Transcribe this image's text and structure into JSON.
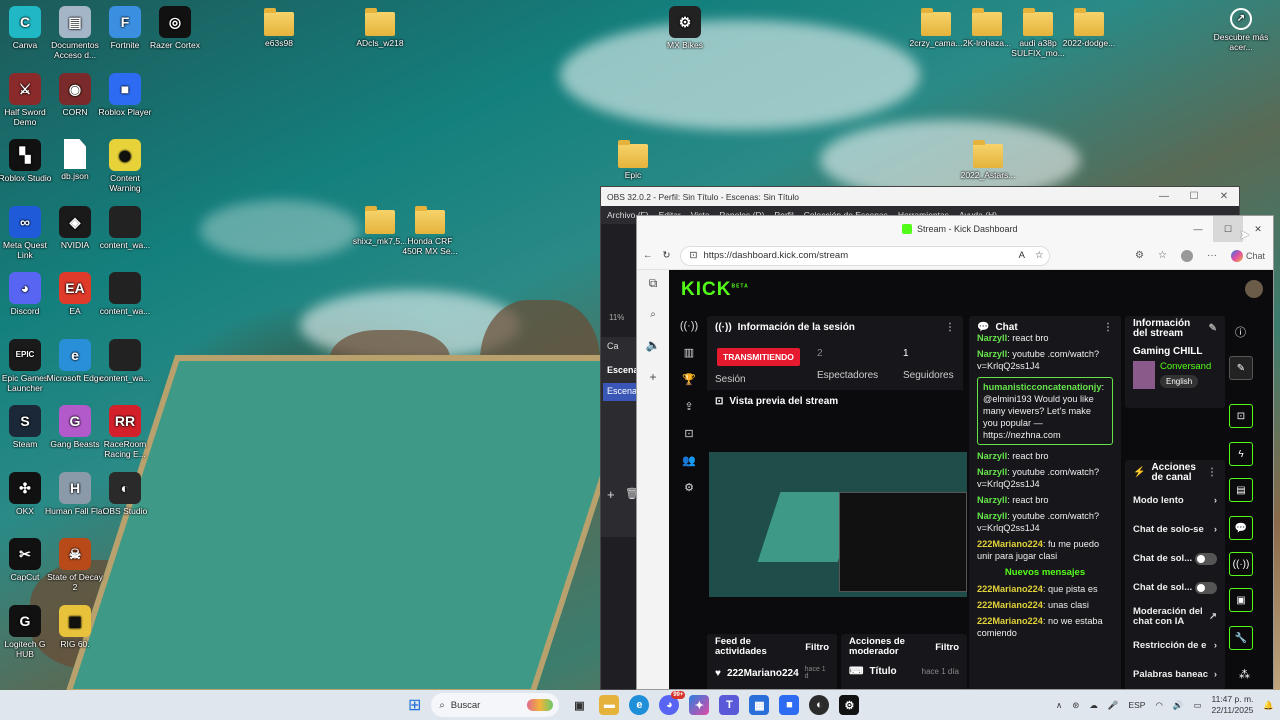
{
  "desktop": {
    "icons_left": [
      {
        "label": "Canva",
        "color": "#1fb8c4",
        "glyph": "C"
      },
      {
        "label": "Documentos Acceso d...",
        "color": "#a5b5c8",
        "glyph": "▤"
      },
      {
        "label": "Fortnite",
        "color": "#3b8fe0",
        "glyph": "F"
      },
      {
        "label": "Razer Cortex",
        "color": "#111111",
        "glyph": "◎"
      },
      {
        "label": "Half Sword Demo",
        "color": "#8a2a2a",
        "glyph": "⚔"
      },
      {
        "label": "CORN",
        "color": "#7a2a2a",
        "glyph": "◉"
      },
      {
        "label": "Roblox Player",
        "color": "#2d6bf2",
        "glyph": "■"
      },
      {
        "label": "Roblox Studio",
        "color": "#111111",
        "glyph": "▚"
      },
      {
        "label": "db.json",
        "color": "#ffffff",
        "glyph": ""
      },
      {
        "label": "Content Warning",
        "color": "#e8d23a",
        "glyph": "◉"
      },
      {
        "label": "Meta Quest Link",
        "color": "#1f5ad9",
        "glyph": "∞"
      },
      {
        "label": "NVIDIA",
        "color": "#1a1a1a",
        "glyph": "◈"
      },
      {
        "label": "content_wa...",
        "color": "#222222",
        "glyph": ""
      },
      {
        "label": "Discord",
        "color": "#5865f2",
        "glyph": "◕"
      },
      {
        "label": "EA",
        "color": "#e03a2a",
        "glyph": "EA"
      },
      {
        "label": "content_wa...",
        "color": "#222222",
        "glyph": ""
      },
      {
        "label": "Epic Games Launcher",
        "color": "#1a1a1a",
        "glyph": "EPIC"
      },
      {
        "label": "Microsoft Edge",
        "color": "#2a8fd9",
        "glyph": "e"
      },
      {
        "label": "content_wa...",
        "color": "#222222",
        "glyph": ""
      },
      {
        "label": "Steam",
        "color": "#1b2838",
        "glyph": "S"
      },
      {
        "label": "Gang Beasts",
        "color": "#b25ac9",
        "glyph": "G"
      },
      {
        "label": "RaceRoom Racing E...",
        "color": "#d3202a",
        "glyph": "RR"
      },
      {
        "label": "OKX",
        "color": "#111111",
        "glyph": "✣"
      },
      {
        "label": "Human Fall Flat",
        "color": "#8a9aa8",
        "glyph": "H"
      },
      {
        "label": "OBS Studio",
        "color": "#2a2a2a",
        "glyph": "◐"
      },
      {
        "label": "CapCut",
        "color": "#111111",
        "glyph": "✂"
      },
      {
        "label": "State of Decay 2",
        "color": "#b84a1a",
        "glyph": "☠"
      },
      {
        "label": "Logitech G HUB",
        "color": "#111111",
        "glyph": "G"
      },
      {
        "label": "RIG 60.",
        "color": "#e8c23a",
        "glyph": "▣"
      }
    ],
    "icons_top": [
      {
        "label": "e63s98"
      },
      {
        "label": "ADcls_w218"
      },
      {
        "label": "MX Bikes"
      },
      {
        "label": "2crzy_cama..."
      },
      {
        "label": "2K-lrohaza..."
      },
      {
        "label": "audi a38p SULFIX_mo..."
      },
      {
        "label": "2022-dodge..."
      },
      {
        "label": "Descubre más acer..."
      },
      {
        "label": "Epic"
      },
      {
        "label": "2022_Astars..."
      },
      {
        "label": "shixz_mk7,5..."
      },
      {
        "label": "Honda CRF 450R MX Se..."
      }
    ]
  },
  "obs": {
    "title": "OBS 32.0.2 - Perfil: Sin Título - Escenas: Sin Título",
    "menu": [
      "Archivo (F)",
      "Editar",
      "Vista",
      "Paneles (D)",
      "Perfil",
      "Colección de Escenas",
      "Herramientas",
      "Ayuda (H)"
    ],
    "scenes_header": "Escenas",
    "scene_item": "Escena",
    "ca": "Ca",
    "zoom": "11%"
  },
  "edge": {
    "tab_title": "Stream - Kick Dashboard",
    "url": "https://dashboard.kick.com/stream",
    "chat_btn": "Chat"
  },
  "kick": {
    "logo": "KICK",
    "logo_tag": "BETA",
    "session": {
      "title": "Información de la sesión",
      "live_badge": "TRANSMITIENDO",
      "session_label": "Sesión",
      "viewers_value": "2",
      "viewers_label": "Espectadores",
      "followers_value": "1",
      "followers_label": "Seguidores"
    },
    "preview_title": "Vista previa del stream",
    "feed": {
      "title": "Feed de actividades",
      "filter": "Filtro",
      "user": "222Mariano224",
      "ago": "hace 1 d"
    },
    "modactions": {
      "title": "Acciones de moderador",
      "filter": "Filtro",
      "item": "Título",
      "ago": "hace 1 día"
    },
    "chat": {
      "title": "Chat",
      "messages": [
        {
          "user": "Narzyll",
          "text": "react bro"
        },
        {
          "user": "Narzyll",
          "text": "youtube .com/watch?v=KrlqQ2ss1J4"
        },
        {
          "user": "humanisticconcatenationjy",
          "text": "@elmini193 Would you like many viewers? Let's make you popular — https://nezhna.com"
        },
        {
          "user": "Narzyll",
          "text": "react bro"
        },
        {
          "user": "Narzyll",
          "text": "youtube .com/watch?v=KrlqQ2ss1J4"
        },
        {
          "user": "Narzyll",
          "text": "react bro"
        },
        {
          "user": "Narzyll",
          "text": "youtube .com/watch?v=KrlqQ2ss1J4"
        },
        {
          "user": "222Mariano224",
          "text": "fu me puedo unir para jugar clasi"
        }
      ],
      "new_messages": "Nuevos mensajes",
      "new": [
        {
          "user": "222Mariano224",
          "text": "que pista es"
        },
        {
          "user": "222Mariano224",
          "text": "unas clasi"
        },
        {
          "user": "222Mariano224",
          "text": "no we estaba comiendo"
        }
      ]
    },
    "stream_info": {
      "title": "Información del stream",
      "stream_title": "Gaming CHILL",
      "category": "Conversand",
      "lang": "English"
    },
    "channel_actions": {
      "title": "Acciones de canal",
      "rows": [
        {
          "label": "Modo lento",
          "kind": "arrow"
        },
        {
          "label": "Chat de solo-se",
          "kind": "arrow"
        },
        {
          "label": "Chat de sol...",
          "kind": "toggle"
        },
        {
          "label": "Chat de sol...",
          "kind": "toggle"
        },
        {
          "label": "Moderación del chat con IA",
          "kind": "ext"
        },
        {
          "label": "Restricción de e",
          "kind": "arrow"
        },
        {
          "label": "Palabras baneac",
          "kind": "arrow"
        }
      ]
    }
  },
  "taskbar": {
    "search_placeholder": "Buscar",
    "lang": "ESP",
    "time": "11:47 p. m.",
    "date": "22/11/2025",
    "badge": "99+"
  }
}
